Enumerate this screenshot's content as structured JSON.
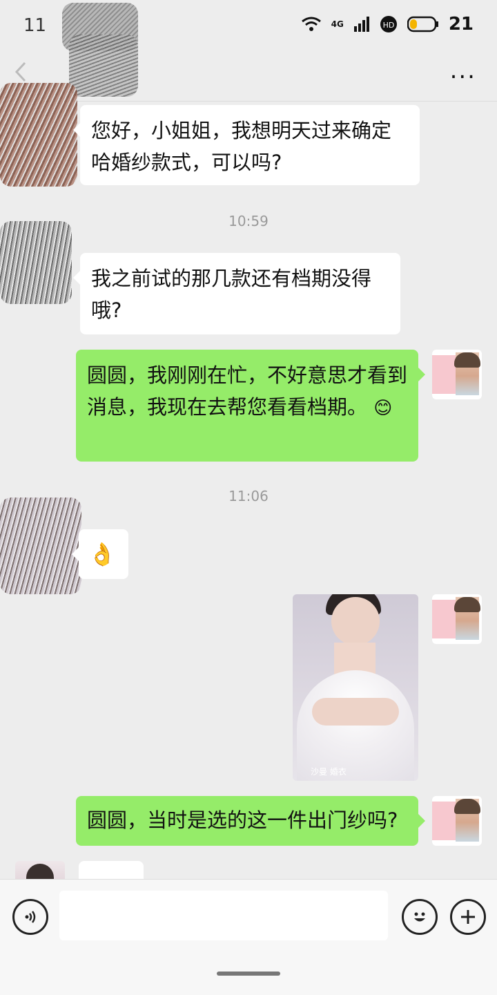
{
  "status_bar": {
    "time": "11",
    "network": "4G",
    "battery": "21"
  },
  "nav": {
    "back_icon": "chevron-left-icon",
    "more_label": "..."
  },
  "messages": [
    {
      "side": "left",
      "text": "您好，小姐姐，我想明天过来确定哈婚纱款式，可以吗?"
    },
    {
      "timestamp": "10:59"
    },
    {
      "side": "left",
      "text": "我之前试的那几款还有档期没得哦?"
    },
    {
      "side": "right",
      "text": "圆圆，我刚刚在忙，不好意思才看到消息，我现在去帮您看看档期。",
      "emoji": "😊"
    },
    {
      "timestamp": "11:06"
    },
    {
      "side": "left",
      "emoji": "👌"
    },
    {
      "side": "right",
      "image_caption": "沙曼 婚衣"
    },
    {
      "side": "right",
      "text": "圆圆，当时是选的这一件出门纱吗?"
    }
  ],
  "input": {
    "placeholder": ""
  },
  "colors": {
    "background": "#ededed",
    "right_bubble": "#95ec69",
    "left_bubble": "#ffffff"
  }
}
